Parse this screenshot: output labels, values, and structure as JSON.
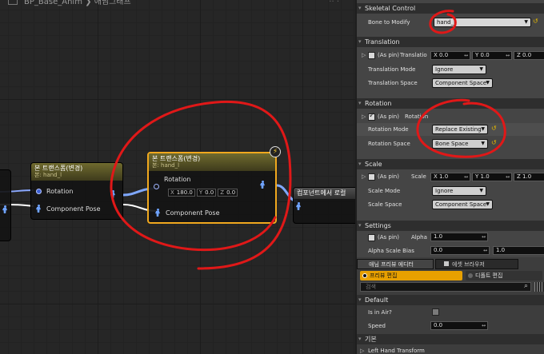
{
  "graph": {
    "title": "BP_Base_Anim",
    "breadcrumb": "애님그래프",
    "left_node": {
      "title": "본 트랜스폼(변경)",
      "subtitle": "본: hand_l",
      "pin_rotation": "Rotation",
      "pin_pose": "Component Pose"
    },
    "main_node": {
      "title": "본 트랜스폼(변경)",
      "subtitle": "본: hand_l",
      "pin_rotation": "Rotation",
      "x_axis": "X",
      "x_value": "180.0",
      "y_axis": "Y",
      "y_value": "0.0",
      "z_axis": "Z",
      "z_value": "0.0",
      "pin_pose": "Component Pose"
    },
    "right_node": {
      "title": "컴포넌트에서 로컬"
    }
  },
  "details": {
    "skeletal": {
      "header": "Skeletal Control",
      "bone_label": "Bone to Modify",
      "bone_value": "hand_l"
    },
    "translation": {
      "header": "Translation",
      "aspin": "(As pin)",
      "row_label": "Translatio",
      "x_axis": "X",
      "x_value": "0.0",
      "y_axis": "Y",
      "y_value": "0.0",
      "z_axis": "Z",
      "z_value": "0.0",
      "mode_label": "Translation Mode",
      "mode_value": "Ignore",
      "space_label": "Translation Space",
      "space_value": "Component Space"
    },
    "rotation": {
      "header": "Rotation",
      "aspin": "(As pin)",
      "row_label": "Rotation",
      "mode_label": "Rotation Mode",
      "mode_value": "Replace Existing",
      "space_label": "Rotation Space",
      "space_value": "Bone Space"
    },
    "scale": {
      "header": "Scale",
      "aspin": "(As pin)",
      "row_label": "Scale",
      "x_axis": "X",
      "x_value": "1.0",
      "y_axis": "Y",
      "y_value": "1.0",
      "z_axis": "Z",
      "z_value": "1.0",
      "mode_label": "Scale Mode",
      "mode_value": "Ignore",
      "space_label": "Scale Space",
      "space_value": "Component Space"
    },
    "settings": {
      "header": "Settings",
      "aspin": "(As pin)",
      "alpha_label": "Alpha",
      "alpha_value": "1.0",
      "bias_label": "Alpha Scale Bias",
      "bias_min": "0.0",
      "bias_max": "1.0"
    }
  },
  "bottom": {
    "tab1": "애님 프리뷰 에디터",
    "tab2": "에셋 브라우저",
    "subtab_active": "프리뷰 편집",
    "subtab_default": "디폴트 편집",
    "search_placeholder": "검색",
    "default_header": "Default",
    "in_air_label": "Is in Air?",
    "speed_label": "Speed",
    "speed_value": "0.0",
    "basic_header": "기본",
    "left_hand_label": "Left Hand Transform"
  },
  "colors": {
    "annotation": "#e01818",
    "node_selected_border": "#f0a81e",
    "tab_active": "#e8a000"
  }
}
